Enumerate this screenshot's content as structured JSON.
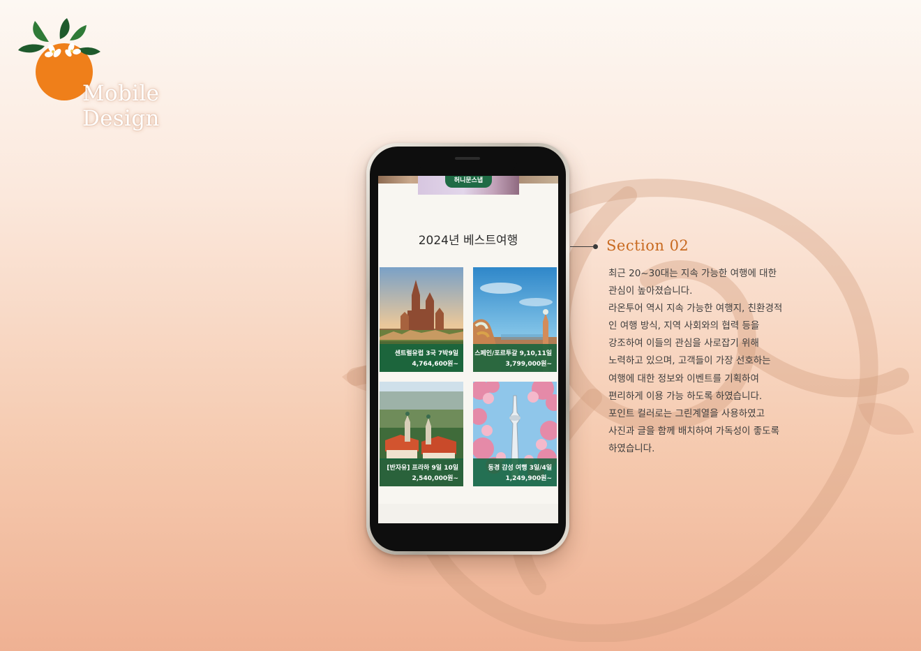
{
  "logo": {
    "text": "Mobile Design"
  },
  "phone": {
    "badge_label": "허니문스냅",
    "section_title": "2024년 베스트여행",
    "cards": [
      {
        "name": "센트럴유럽 3국 7박9일",
        "price": "4,764,600원~"
      },
      {
        "name": "스페인/포르투갈 9,10,11일",
        "price": "3,799,000원~"
      },
      {
        "name": "[반자유] 프라하 9일 10일",
        "price": "2,540,000원~"
      },
      {
        "name": "동경 감성 여행 3일/4일",
        "price": "1,249,900원~"
      }
    ]
  },
  "description": {
    "heading": "Section 02",
    "lines": [
      "최근 20~30대는 지속 가능한 여행에 대한",
      "관심이 높아졌습니다.",
      "라온투어 역시 지속 가능한 여행지, 친환경적",
      "인 여행 방식, 지역 사회와의 협력 등을",
      "강조하여 이들의 관심을 사로잡기 위해",
      "노력하고 있으며, 고객들이 가장 선호하는",
      "여행에 대한 정보와 이벤트를 기획하여",
      "편리하게 이용 가능 하도록 하였습니다.",
      "포인트 컬러로는 그린계열을 사용하였고",
      "사진과 글을 함께 배치하여 가독성이 좋도록",
      "하였습니다."
    ]
  },
  "colors": {
    "accent_green": "#1f6b45",
    "heading_orange": "#c8691f",
    "logo_orange": "#ef7f1a"
  },
  "icons": {
    "logo_mark": "orange-fruit-with-leaves-icon",
    "watermark": "ornamental-letter-watermark"
  }
}
